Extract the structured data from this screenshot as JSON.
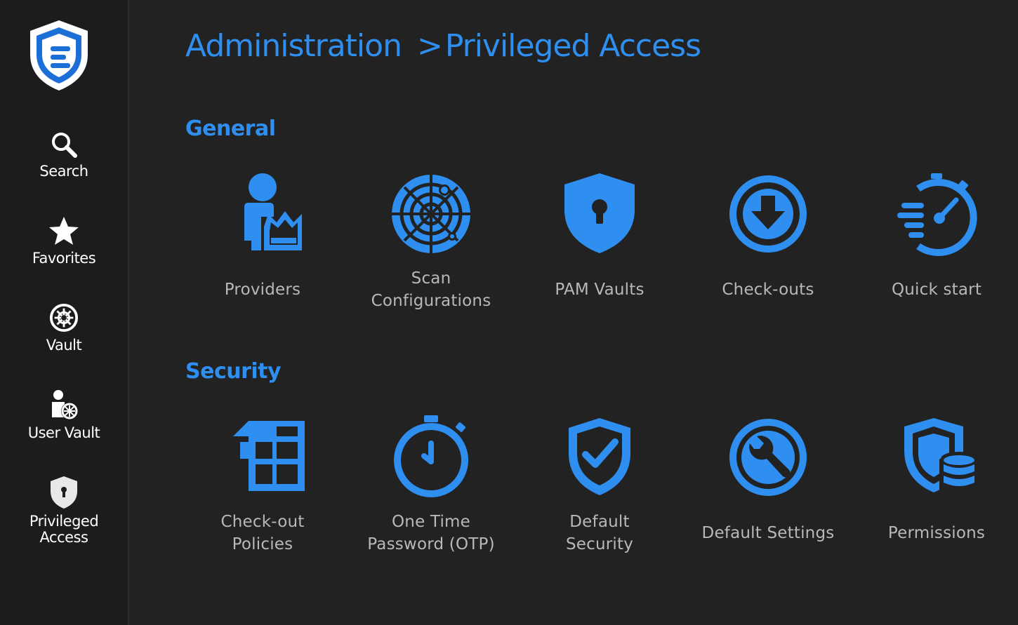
{
  "breadcrumb": {
    "root": "Administration",
    "separator": ">",
    "current": "Privileged Access"
  },
  "sidebar": {
    "items": [
      {
        "label": "Search",
        "icon": "search-icon"
      },
      {
        "label": "Favorites",
        "icon": "star-icon"
      },
      {
        "label": "Vault",
        "icon": "vault-icon"
      },
      {
        "label": "User Vault",
        "icon": "user-vault-icon"
      },
      {
        "label": "Privileged\nAccess",
        "icon": "shield-lock-icon"
      }
    ]
  },
  "sections": [
    {
      "title": "General",
      "tiles": [
        {
          "label": "Providers",
          "icon": "provider-icon"
        },
        {
          "label": "Scan\nConfigurations",
          "icon": "radar-icon"
        },
        {
          "label": "PAM Vaults",
          "icon": "shield-lock-icon"
        },
        {
          "label": "Check-outs",
          "icon": "download-circle-icon"
        },
        {
          "label": "Quick start",
          "icon": "stopwatch-speed-icon"
        }
      ]
    },
    {
      "title": "Security",
      "tiles": [
        {
          "label": "Check-out\nPolicies",
          "icon": "policy-grid-icon"
        },
        {
          "label": "One Time\nPassword (OTP)",
          "icon": "timer-icon"
        },
        {
          "label": "Default\nSecurity",
          "icon": "shield-check-icon"
        },
        {
          "label": "Default Settings",
          "icon": "wrench-icon"
        },
        {
          "label": "Permissions",
          "icon": "shield-database-icon"
        }
      ]
    }
  ],
  "colors": {
    "accent": "#2f8ff0",
    "background": "#222222",
    "sidebar_background": "#1c1c1c",
    "tile_label": "#b8b8b8"
  }
}
